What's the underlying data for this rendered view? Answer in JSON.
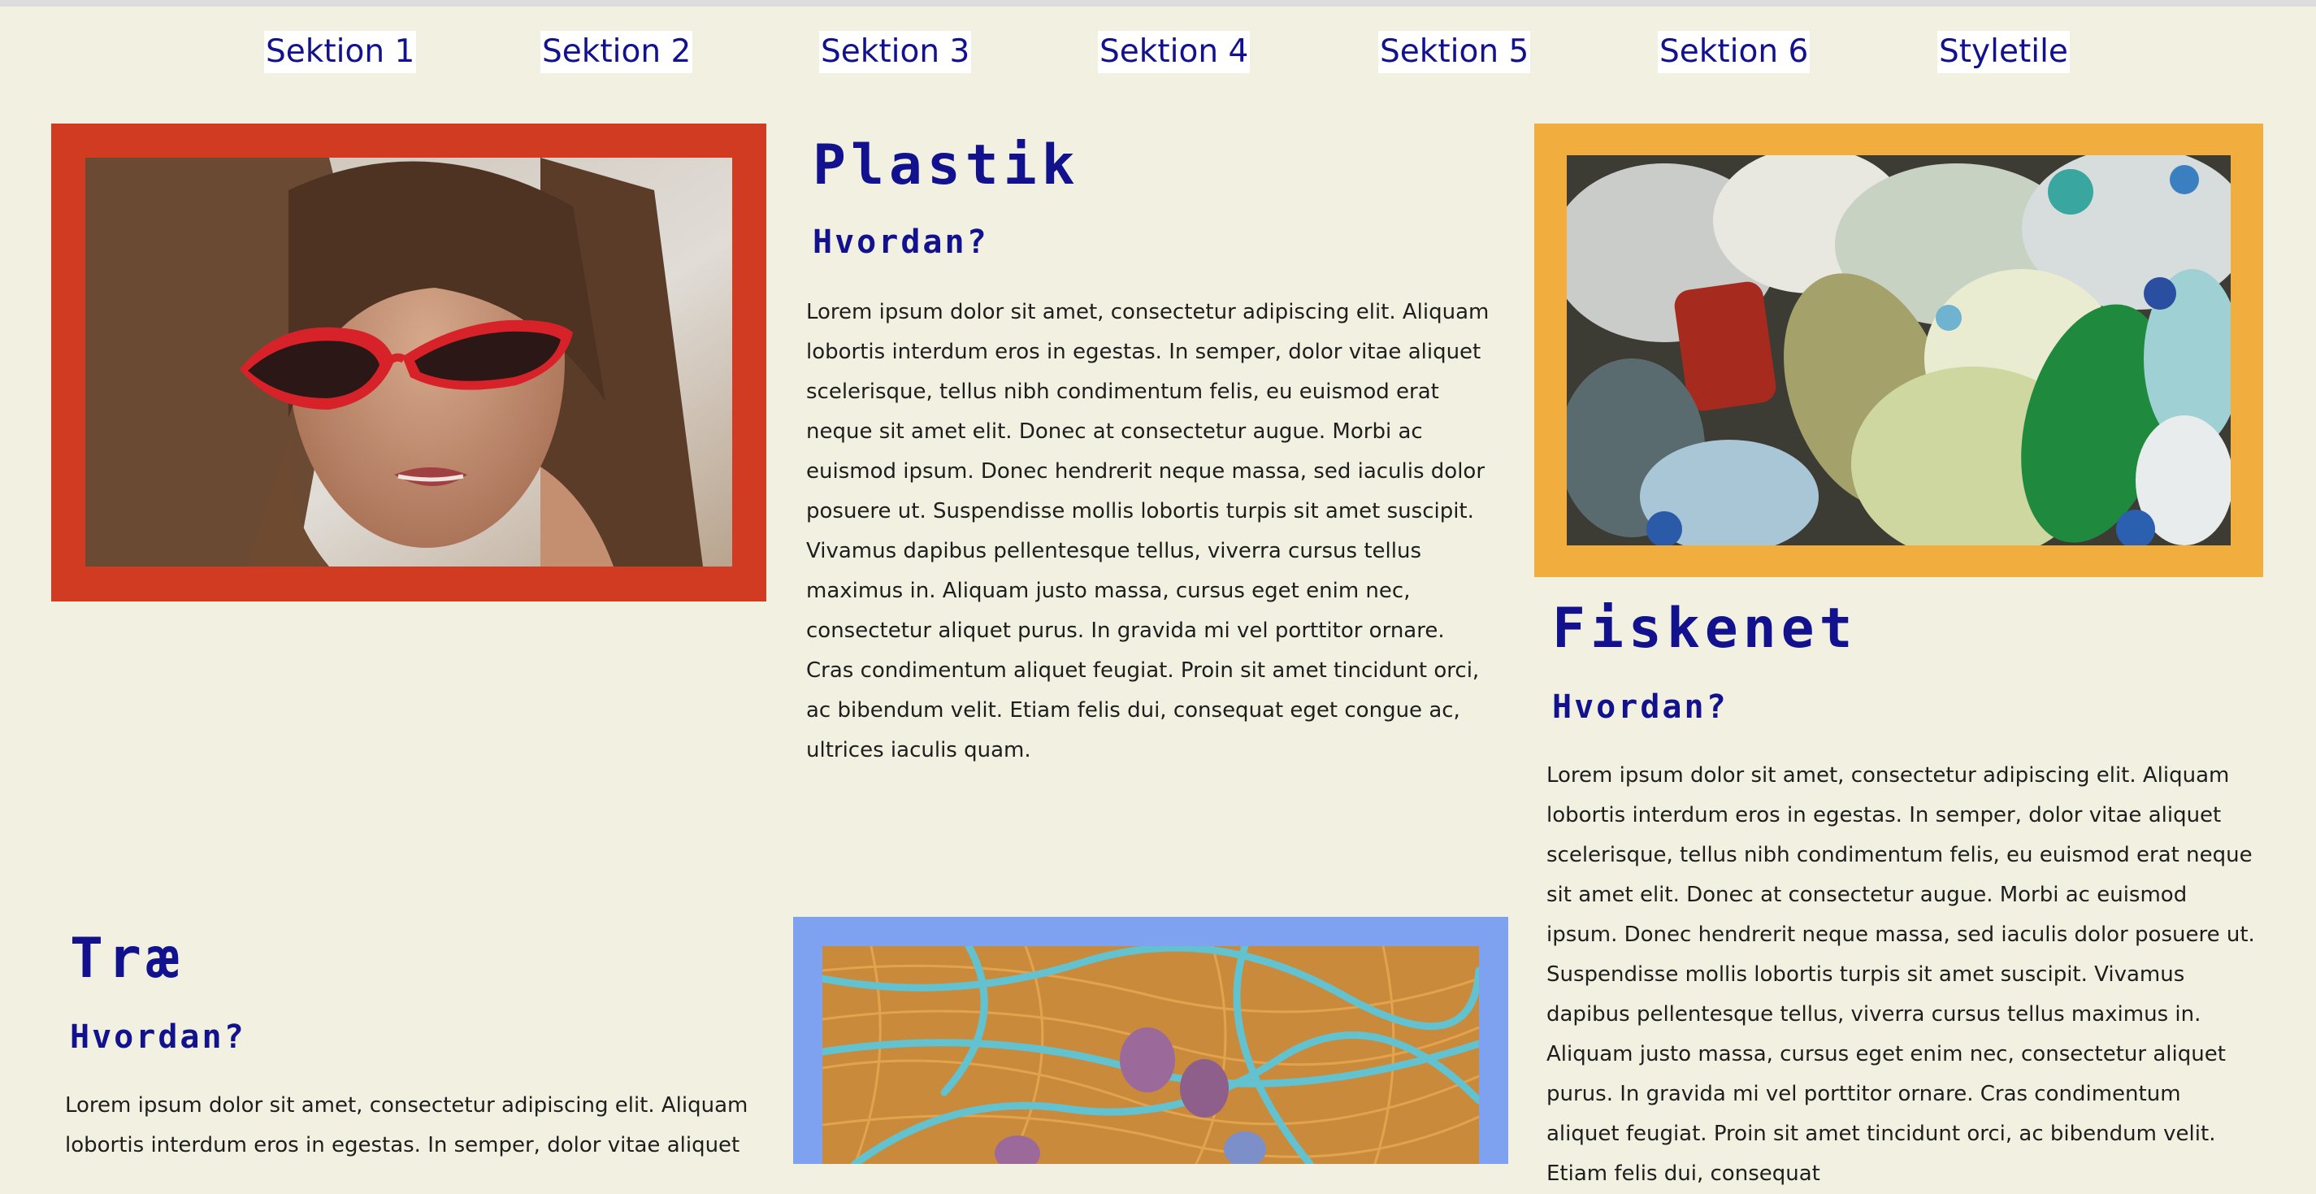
{
  "nav": {
    "items": [
      {
        "label": "Sektion 1"
      },
      {
        "label": "Sektion 2"
      },
      {
        "label": "Sektion 3"
      },
      {
        "label": "Sektion 4"
      },
      {
        "label": "Sektion 5"
      },
      {
        "label": "Sektion 6"
      },
      {
        "label": "Styletile"
      }
    ]
  },
  "sections": {
    "plastik": {
      "title": "Plastik",
      "subtitle": "Hvordan?",
      "body": "Lorem ipsum dolor sit amet, consectetur adipiscing elit. Aliquam lobortis interdum eros in egestas. In semper, dolor vitae aliquet scelerisque, tellus nibh condimentum felis, eu euismod erat neque sit amet elit. Donec at consectetur augue. Morbi ac euismod ipsum. Donec hendrerit neque massa, sed iaculis dolor posuere ut. Suspendisse mollis lobortis turpis sit amet suscipit. Vivamus dapibus pellentesque tellus, viverra cursus tellus maximus in. Aliquam justo massa, cursus eget enim nec, consectetur aliquet purus. In gravida mi vel porttitor ornare. Cras condimentum aliquet feugiat. Proin sit amet tincidunt orci, ac bibendum velit. Etiam felis dui, consequat eget congue ac, ultrices iaculis quam."
    },
    "fiskenet": {
      "title": "Fiskenet",
      "subtitle": "Hvordan?",
      "body": "Lorem ipsum dolor sit amet, consectetur adipiscing elit. Aliquam lobortis interdum eros in egestas. In semper, dolor vitae aliquet scelerisque, tellus nibh condimentum felis, eu euismod erat neque sit amet elit. Donec at consectetur augue. Morbi ac euismod ipsum. Donec hendrerit neque massa, sed iaculis dolor posuere ut. Suspendisse mollis lobortis turpis sit amet suscipit. Vivamus dapibus pellentesque tellus, viverra cursus tellus maximus in. Aliquam justo massa, cursus eget enim nec, consectetur aliquet purus. In gravida mi vel porttitor ornare. Cras condimentum aliquet feugiat. Proin sit amet tincidunt orci, ac bibendum velit. Etiam felis dui, consequat"
    },
    "trae": {
      "title": "Træ",
      "subtitle": "Hvordan?",
      "body": "Lorem ipsum dolor sit amet, consectetur adipiscing elit. Aliquam lobortis interdum eros in egestas. In semper, dolor vitae aliquet"
    }
  },
  "colors": {
    "background": "#f2f0e1",
    "heading": "#12128f",
    "frame_red": "#d13b22",
    "frame_orange": "#f2ad3f",
    "frame_blue": "#7fa2f0"
  },
  "images": {
    "woman": "woman-red-sunglasses-photo",
    "plastic": "plastic-bottles-pile-photo",
    "net": "fishing-net-photo"
  }
}
